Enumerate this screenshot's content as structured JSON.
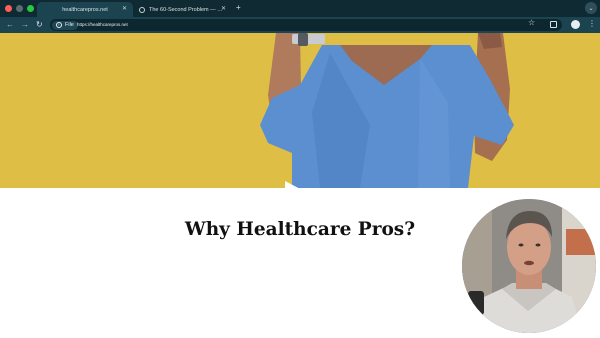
{
  "browser": {
    "tabs": [
      {
        "title": "healthcarepros.net",
        "active": true
      },
      {
        "title": "The 60-Second Problem — …",
        "active": false
      }
    ],
    "new_tab_symbol": "+",
    "omnibox": {
      "chip_label": "File",
      "url": "https://healthcarepros.net"
    },
    "icons": {
      "back": "back-arrow-icon",
      "forward": "forward-arrow-icon",
      "reload": "reload-icon",
      "bookmark": "star-icon",
      "extensions": "puzzle-icon",
      "profile": "profile-icon",
      "menu": "kebab-menu-icon"
    }
  },
  "hero": {
    "background_color": "#dfbe45",
    "play_button": "play-icon"
  },
  "main": {
    "heading": "Why Healthcare Pros?"
  },
  "colors": {
    "tabbar": "#0f2a33",
    "toolbar": "#1c4350",
    "scrubs": "#5b8fd0"
  }
}
